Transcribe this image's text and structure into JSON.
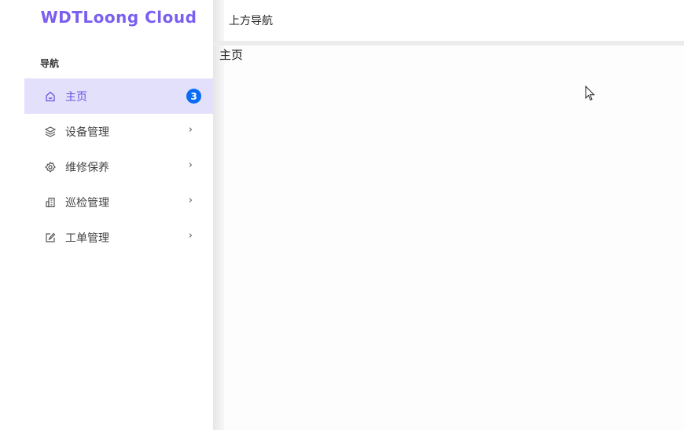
{
  "sidebar": {
    "logo": "WDTLoong Cloud",
    "section_title": "导航",
    "items": [
      {
        "label": "主页",
        "icon": "home-icon",
        "badge": "3",
        "active": true
      },
      {
        "label": "设备管理",
        "icon": "layers-icon",
        "chevron": "›"
      },
      {
        "label": "维修保养",
        "icon": "gear-icon",
        "chevron": "›"
      },
      {
        "label": "巡检管理",
        "icon": "building-icon",
        "chevron": "›"
      },
      {
        "label": "工单管理",
        "icon": "edit-icon",
        "chevron": "›"
      }
    ]
  },
  "header": {
    "title": "上方导航"
  },
  "main": {
    "content": "主页"
  },
  "colors": {
    "brand": "#7b5ff0",
    "active_bg": "#e3e0fb",
    "badge": "#0a6cf5"
  }
}
